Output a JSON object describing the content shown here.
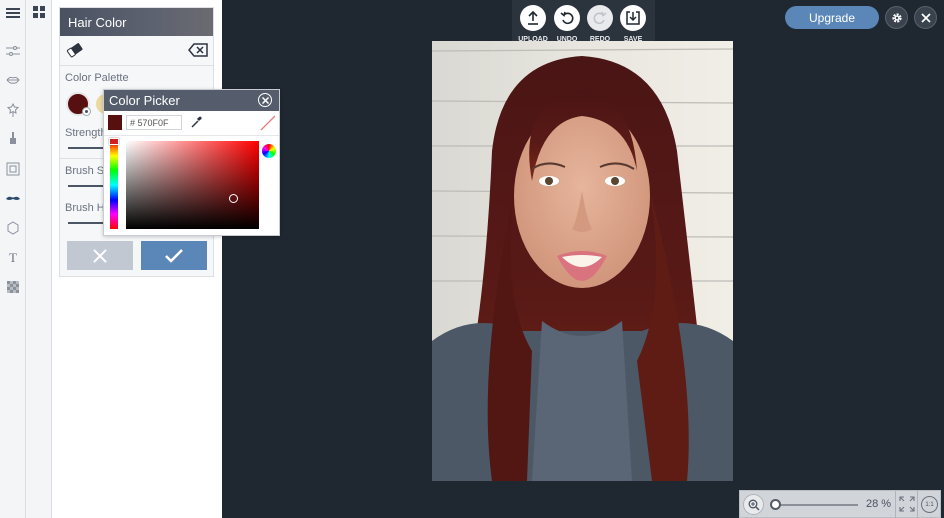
{
  "rail": {
    "items": [
      {
        "icon": "menu-icon"
      },
      {
        "icon": "adjustments-icon"
      },
      {
        "icon": "lips-icon"
      },
      {
        "icon": "wand-icon"
      },
      {
        "icon": "brush-icon"
      },
      {
        "icon": "frame-icon"
      },
      {
        "icon": "mustache-icon"
      },
      {
        "icon": "shape-icon"
      },
      {
        "icon": "text-icon"
      },
      {
        "icon": "texture-icon"
      }
    ],
    "grid_icon": "grid-icon"
  },
  "panel": {
    "title": "Hair Color",
    "color_palette_label": "Color Palette",
    "strength_label": "Strength",
    "brush_size_label": "Brush Si",
    "brush_hardness_label": "Brush Ha",
    "selected_color": "#570f0f",
    "secondary_swatch_color": "#ecd9a2"
  },
  "color_picker": {
    "title": "Color Picker",
    "hex_value": "# 570F0F",
    "current_color": "#570f0f"
  },
  "toolbar": {
    "upload_label": "UPLOAD",
    "undo_label": "UNDO",
    "redo_label": "REDO",
    "save_label": "SAVE"
  },
  "header": {
    "upgrade_label": "Upgrade"
  },
  "zoom": {
    "percent_label": "28 %",
    "value": 28
  },
  "colors": {
    "accent": "#5b87b8",
    "canvas_bg": "#1f2731"
  }
}
